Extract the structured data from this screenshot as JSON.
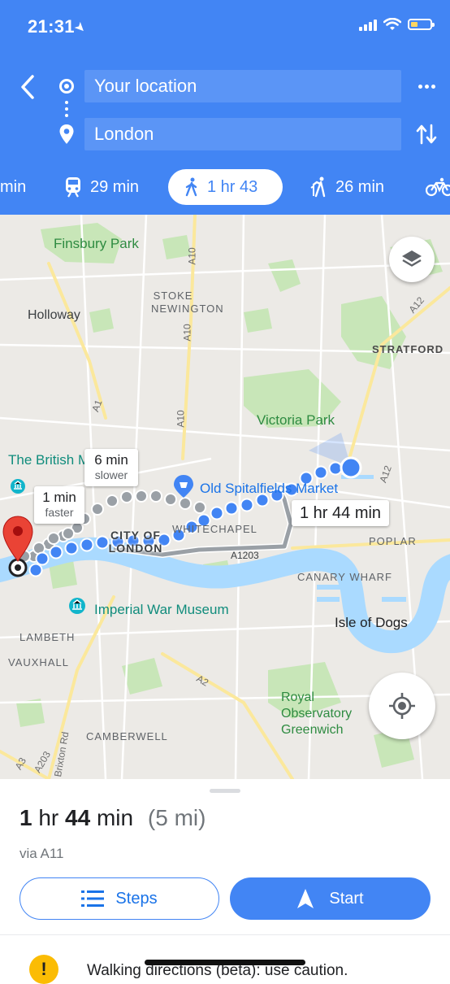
{
  "status_bar": {
    "time": "21:31",
    "battery_color": "#fdd663"
  },
  "header": {
    "background_color": "#4285f4",
    "back_icon": "back-arrow-icon",
    "origin": "Your location",
    "destination": "London",
    "more_icon": "more-horizontal-icon",
    "swap_icon": "swap-vertical-icon"
  },
  "travel_modes": [
    {
      "mode": "drive",
      "icon": "car-icon",
      "label": "min",
      "selected": false
    },
    {
      "mode": "transit",
      "icon": "train-icon",
      "label": "29 min",
      "selected": false
    },
    {
      "mode": "walk",
      "icon": "walking-icon",
      "label": "1 hr 43",
      "selected": true
    },
    {
      "mode": "ride",
      "icon": "ride-hail-icon",
      "label": "26 min",
      "selected": false
    },
    {
      "mode": "cycle",
      "icon": "bicycle-icon",
      "label": "",
      "selected": false
    }
  ],
  "map": {
    "labels": {
      "finsbury_park": "Finsbury Park",
      "stoke_newington": "STOKE NEWINGTON",
      "holloway": "Holloway",
      "stratford": "STRATFORD",
      "victoria_park": "Victoria Park",
      "british_museum": "The British M",
      "old_spitalfields": "Old Spitalfields Market",
      "whitechapel": "WHITECHAPEL",
      "city_of_london": "CITY OF LONDON",
      "poplar": "POPLAR",
      "canary_wharf": "CANARY WHARF",
      "imperial_war_museum": "Imperial War Museum",
      "isle_of_dogs": "Isle of Dogs",
      "lambeth": "LAMBETH",
      "vauxhall": "VAUXHALL",
      "royal_observatory": "Royal Observatory Greenwich",
      "camberwell": "CAMBERWELL",
      "brixton_rd": "Brixton Rd",
      "road_a10_1": "A10",
      "road_a10_2": "A10",
      "road_a10_3": "A10",
      "road_a12_1": "A12",
      "road_a12_2": "A12",
      "road_a1": "A1",
      "road_a1203": "A1203",
      "road_a2": "A2",
      "road_a3": "A3",
      "road_a203": "A203"
    },
    "route_callouts": {
      "main": "1 hr 44 min",
      "alt_slower_time": "6 min",
      "alt_slower_note": "slower",
      "alt_faster_time": "1 min",
      "alt_faster_note": "faster"
    },
    "layers_icon": "layers-icon",
    "locate_icon": "my-location-icon",
    "colors": {
      "route": "#4285f4",
      "alt_route": "#9aa0a6",
      "water": "#aadaff",
      "park": "#c8e6b8",
      "pin": "#ea4335"
    }
  },
  "sheet": {
    "duration_num": "1",
    "duration_unit": "hr",
    "duration_num2": "44",
    "duration_unit2": "min",
    "distance": "(5 mi)",
    "via": "via A11",
    "steps_label": "Steps",
    "start_label": "Start",
    "warning_icon_glyph": "!",
    "warning_text": "Walking directions (beta): use caution."
  }
}
